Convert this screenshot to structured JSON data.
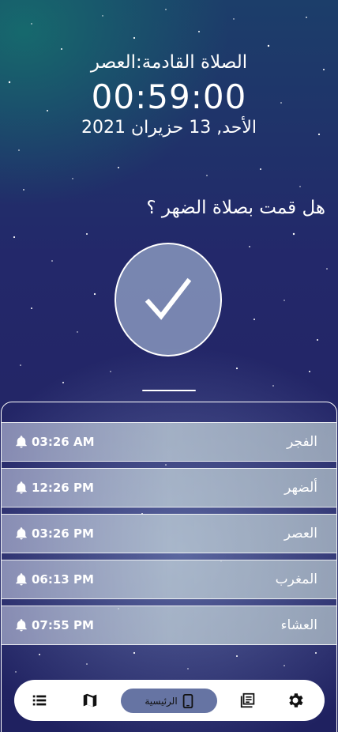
{
  "header": {
    "next_prayer": "الصلاة القادمة:العصر",
    "countdown": "00:59:00",
    "date": "الأحد, 13 حزيران 2021"
  },
  "question": "هل قمت بصلاة الضهر ؟",
  "prayers": [
    {
      "name": "الفجر",
      "time": "03:26 AM"
    },
    {
      "name": "ألضهر",
      "time": "12:26 PM"
    },
    {
      "name": "العصر",
      "time": "03:26 PM"
    },
    {
      "name": "المغرب",
      "time": "06:13 PM"
    },
    {
      "name": "العشاء",
      "time": "07:55 PM"
    }
  ],
  "bottom_nav": {
    "home_label": "الرئيسية",
    "icons": [
      "list-icon",
      "map-icon",
      "phone-icon",
      "books-icon",
      "settings-icon"
    ]
  },
  "colors": {
    "home_pill": "#6674a3",
    "nav_background": "#ffffff"
  }
}
